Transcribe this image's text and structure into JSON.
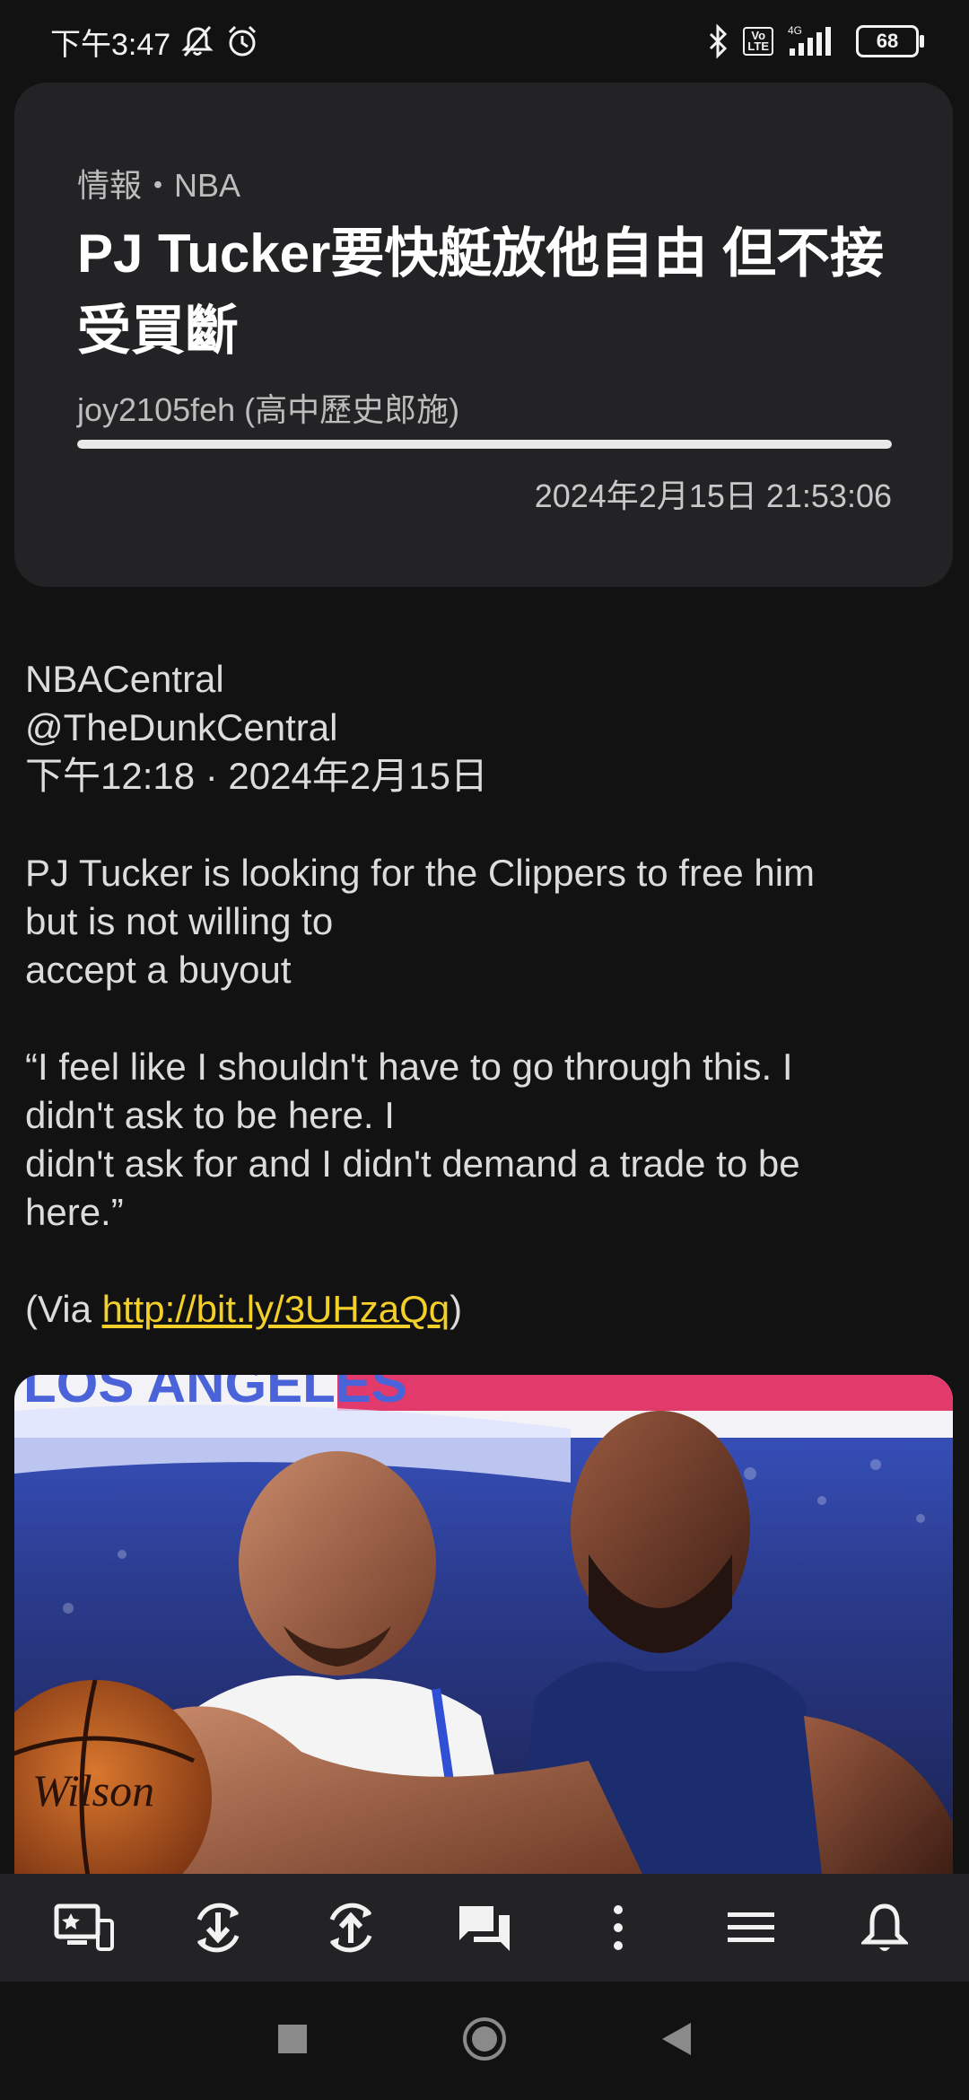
{
  "status_bar": {
    "time": "下午3:47",
    "battery": "68",
    "network": "4G",
    "volte_label": "Vo\nLTE"
  },
  "article_header": {
    "category": "情報・NBA",
    "title": "PJ Tucker要快艇放他自由 但不接受買斷",
    "author": "joy2105feh (高中歷史郎施)",
    "read_progress_percent": 100,
    "date": "2024年2月15日 21:53:06"
  },
  "article_body": {
    "source_name": "NBACentral",
    "source_handle": "@TheDunkCentral",
    "source_time": "下午12:18 · 2024年2月15日",
    "para1_line1": "PJ Tucker is looking for the Clippers to free him",
    "para1_line2": "but is not willing to",
    "para1_line3": "accept a buyout",
    "quote_line1": "“I feel like I shouldn't have to go through this. I",
    "quote_line2": "didn't ask to be here. I",
    "quote_line3": "didn't ask for and I didn't demand a trade to be",
    "quote_line4": "here.”",
    "via_prefix": "(Via ",
    "via_link": "http://bit.ly/3UHzaQq",
    "via_suffix": ")"
  },
  "photo": {
    "jersey_text": "LOS ANGELES",
    "ball_text": "Wilson"
  },
  "toolbar": {
    "items": [
      "screen-icon",
      "download-icon",
      "upload-icon",
      "comments-icon",
      "more-vert-icon",
      "menu-icon",
      "bell-icon"
    ]
  },
  "colors": {
    "background": "#121212",
    "card": "#232325",
    "link": "#f3cf2a",
    "text": "#dcdcdc"
  }
}
